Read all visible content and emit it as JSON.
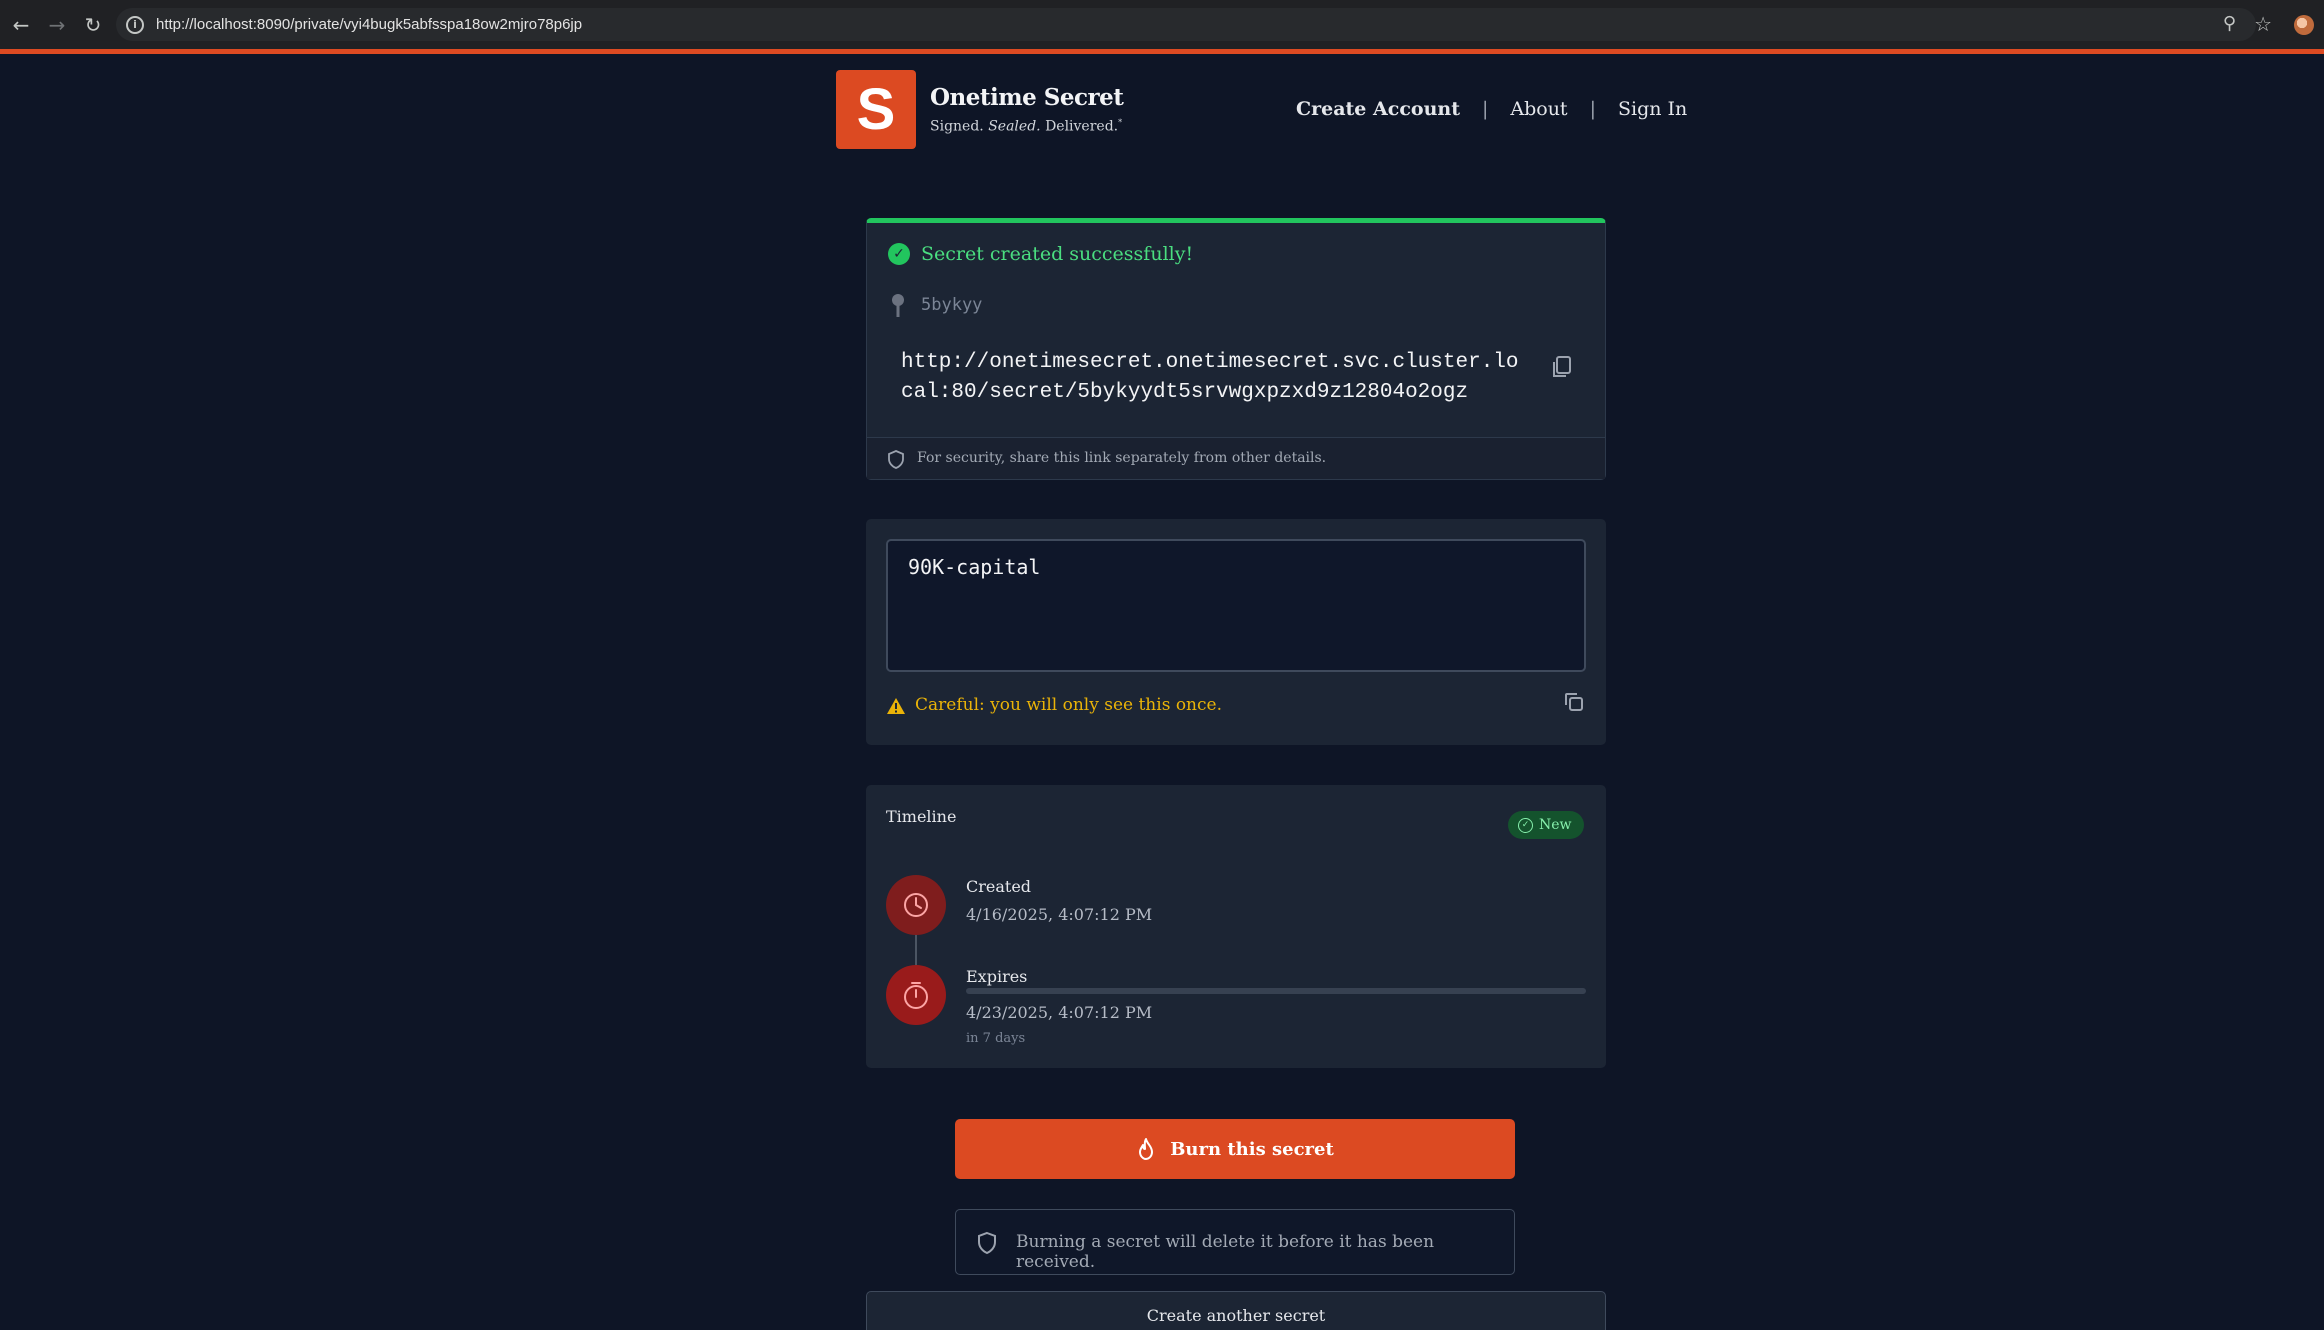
{
  "browser": {
    "url": "http://localhost:8090/private/vyi4bugk5abfsspa18ow2mjro78p6jp"
  },
  "header": {
    "logo_letter": "S",
    "brand_name": "Onetime Secret",
    "tagline_part1": "Signed.",
    "tagline_part2": "Sealed.",
    "tagline_part3": "Delivered.",
    "tagline_mark": "*",
    "nav": {
      "create_account": "Create Account",
      "about": "About",
      "sign_in": "Sign In",
      "separator": "|"
    }
  },
  "success_card": {
    "message": "Secret created successfully!",
    "secret_key": "5bykyy",
    "secret_link": "http://onetimesecret.onetimesecret.svc.cluster.local:80/secret/5bykyydt5srvwgxpzxd9z12804o2ogz",
    "security_note": "For security, share this link separately from other details."
  },
  "secret_value": {
    "value": "90K-capital",
    "warning": "Careful: you will only see this once."
  },
  "timeline": {
    "title": "Timeline",
    "badge": "New",
    "created_label": "Created",
    "created_date": "4/16/2025, 4:07:12 PM",
    "expires_label": "Expires",
    "expires_date": "4/23/2025, 4:07:12 PM",
    "expires_relative": "in 7 days",
    "expiry_progress_fraction": 0
  },
  "actions": {
    "burn_label": "Burn this secret",
    "burn_note": "Burning a secret will delete it before it has been received.",
    "create_another": "Create another secret"
  },
  "colors": {
    "accent": "#dc4a22",
    "success": "#22c55e",
    "warning": "#eab308",
    "background": "#0e1526",
    "card": "#1c2534"
  }
}
